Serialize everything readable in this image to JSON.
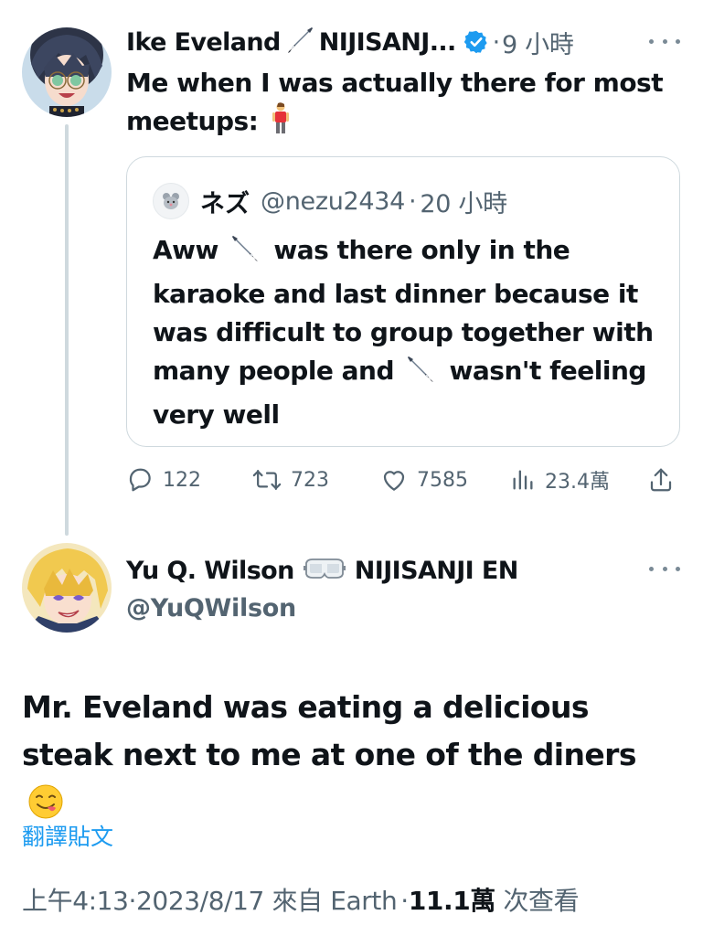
{
  "post": {
    "author_name": "Ike Eveland",
    "author_affiliation": "NIJISANJ...",
    "time_separator": "·",
    "time_ago": "9 小時",
    "text_line": "Me when I was actually there for most meetups:",
    "quote": {
      "name": "ネズ",
      "handle": "@nezu2434",
      "time_separator": "·",
      "time_ago": "20 小時",
      "text_part1": "Aww",
      "text_part2": "was there only in the karaoke and last dinner because it was difficult to group together with many people and",
      "text_part3": "wasn't feeling very well"
    },
    "actions": {
      "replies": "122",
      "reposts": "723",
      "likes": "7585",
      "views": "23.4萬"
    }
  },
  "reply": {
    "author_name": "Yu Q. Wilson",
    "author_affiliation": "NIJISANJI EN",
    "handle": "@YuQWilson",
    "text": "Mr. Eveland was eating a delicious steak next to me at one of the diners",
    "translate_label": "翻譯貼文",
    "timestamp_time": "上午4:13",
    "sep1": "·",
    "timestamp_date": "2023/8/17",
    "source_prefix": "來自",
    "source": "Earth",
    "sep2": "·",
    "views_count": "11.1萬",
    "views_suffix": "次查看"
  },
  "colors": {
    "text_primary": "#0f1419",
    "text_secondary": "#536471",
    "link": "#1d9bf0",
    "verified": "#1d9bf0",
    "border": "#cfd9de"
  },
  "icons": {
    "verified": "verified-badge-icon",
    "more": "more-icon",
    "reply": "reply-icon",
    "repost": "repost-icon",
    "like": "heart-icon",
    "views": "views-icon",
    "share": "share-icon",
    "pen": "fountain-pen-emoji",
    "person": "standing-person-emoji",
    "goggles": "goggles-emoji",
    "face": "savoring-food-emoji"
  }
}
